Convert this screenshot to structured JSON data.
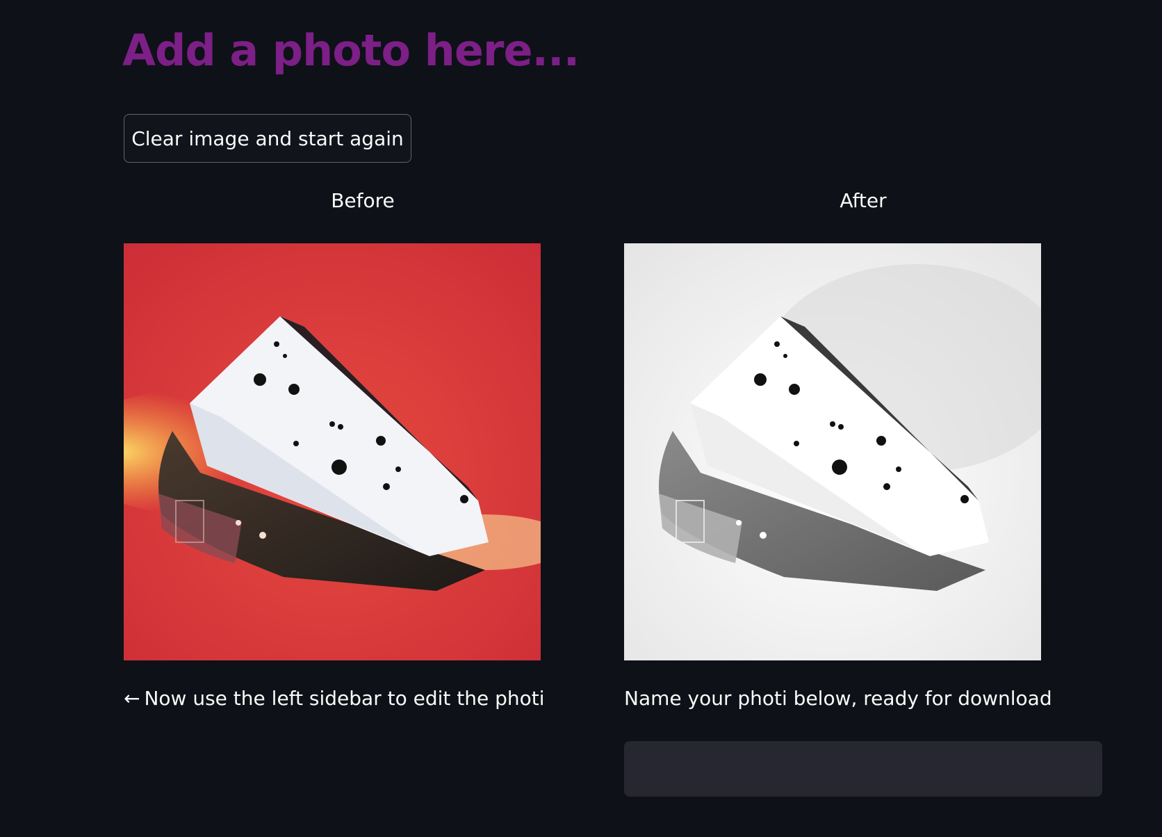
{
  "header": {
    "title": "Add a photo here..."
  },
  "actions": {
    "clear_label": "Clear image and start again"
  },
  "columns": {
    "before_label": "Before",
    "after_label": "After"
  },
  "captions": {
    "left_arrow": "←",
    "left_text": "Now use the left sidebar to edit the photi",
    "right_text": "Name your photi below, ready for download"
  },
  "filename_input": {
    "value": "",
    "placeholder": ""
  },
  "colors": {
    "background": "#0e1117",
    "title": "#7c1f86",
    "input_bg": "#262730",
    "before_photo_bg": "#d8343a"
  },
  "images": {
    "before": "cheese-wedge-photo-red-background",
    "after": "cheese-wedge-photo-grayscale-inverted"
  }
}
